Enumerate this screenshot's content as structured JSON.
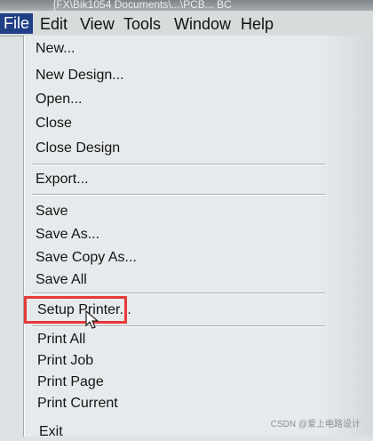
{
  "window": {
    "title": "[FX\\Bik1054 Documents\\...\\PCB... BC"
  },
  "menubar": {
    "file": "File",
    "edit": "Edit",
    "view": "View",
    "tools": "Tools",
    "window": "Window",
    "help": "Help"
  },
  "file_menu": {
    "new": "New...",
    "new_design": "New Design...",
    "open": "Open...",
    "close": "Close",
    "close_design": "Close Design",
    "export": "Export...",
    "save": "Save",
    "save_as": "Save As...",
    "save_copy_as": "Save Copy As...",
    "save_all": "Save All",
    "setup_printer": "Setup Printer...",
    "print_all": "Print All",
    "print_job": "Print Job",
    "print_page": "Print Page",
    "print_current": "Print Current",
    "exit": "Exit"
  },
  "annotation": {
    "highlight_color": "#e53a3a"
  },
  "watermark": "CSDN @爱上电路设计"
}
